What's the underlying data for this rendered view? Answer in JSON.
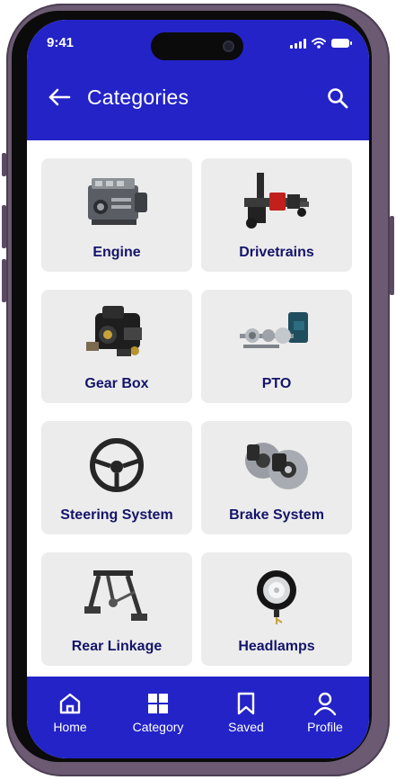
{
  "status_bar": {
    "time": "9:41"
  },
  "header": {
    "title": "Categories",
    "back_icon": "arrow-left-icon",
    "search_icon": "search-icon"
  },
  "categories": [
    {
      "label": "Engine",
      "icon": "engine-image"
    },
    {
      "label": "Drivetrains",
      "icon": "drivetrain-image"
    },
    {
      "label": "Gear Box",
      "icon": "gearbox-image"
    },
    {
      "label": "PTO",
      "icon": "pto-image"
    },
    {
      "label": "Steering System",
      "icon": "steering-wheel-image"
    },
    {
      "label": "Brake System",
      "icon": "brake-disc-image"
    },
    {
      "label": "Rear Linkage",
      "icon": "rear-linkage-image"
    },
    {
      "label": "Headlamps",
      "icon": "headlamp-image"
    }
  ],
  "bottom_nav": [
    {
      "label": "Home",
      "icon": "home-icon"
    },
    {
      "label": "Category",
      "icon": "grid-icon"
    },
    {
      "label": "Saved",
      "icon": "bookmark-icon"
    },
    {
      "label": "Profile",
      "icon": "user-icon"
    }
  ],
  "colors": {
    "primary": "#2323c8",
    "card": "#ececec",
    "label": "#14146a",
    "frame": "#6b5a72"
  }
}
